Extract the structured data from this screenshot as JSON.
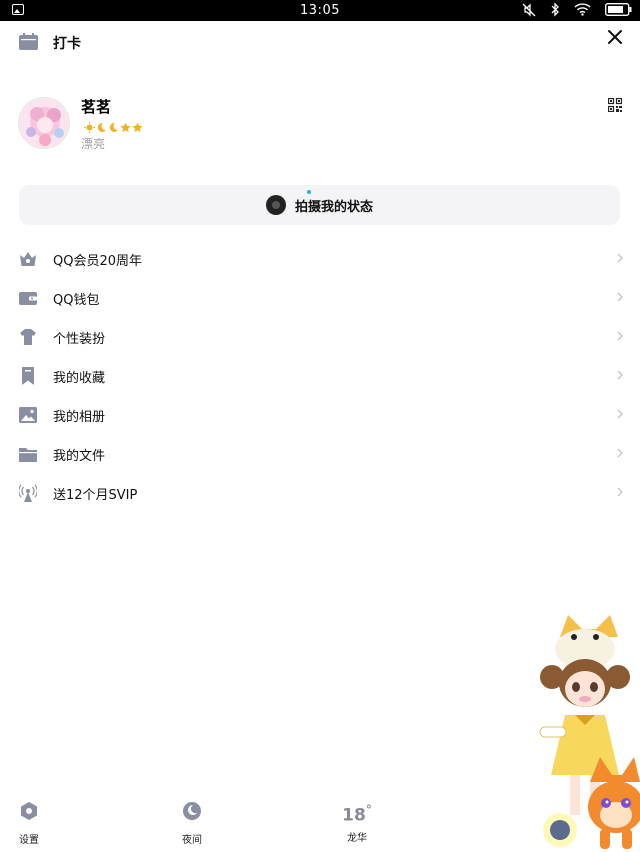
{
  "status_bar": {
    "time": "13:05"
  },
  "header": {
    "checkin_label": "打卡"
  },
  "profile": {
    "name": "茗茗",
    "signature": "漂亮"
  },
  "capture_button": {
    "label": "拍摄我的状态"
  },
  "menu": {
    "items": [
      {
        "label": "QQ会员20周年",
        "icon": "crown-icon"
      },
      {
        "label": "QQ钱包",
        "icon": "wallet-icon"
      },
      {
        "label": "个性装扮",
        "icon": "tshirt-icon"
      },
      {
        "label": "我的收藏",
        "icon": "bookmark-icon"
      },
      {
        "label": "我的相册",
        "icon": "photo-icon"
      },
      {
        "label": "我的文件",
        "icon": "folder-icon"
      },
      {
        "label": "送12个月SVIP",
        "icon": "antenna-icon"
      }
    ]
  },
  "bottom_bar": {
    "settings_label": "设置",
    "night_label": "夜间",
    "weather_temp": "18",
    "weather_unit": "°",
    "weather_city": "龙华"
  },
  "colors": {
    "icon_gray": "#8a8ea3",
    "accent_blue": "#2ab0e8",
    "capture_bg": "#f4f4f6"
  }
}
